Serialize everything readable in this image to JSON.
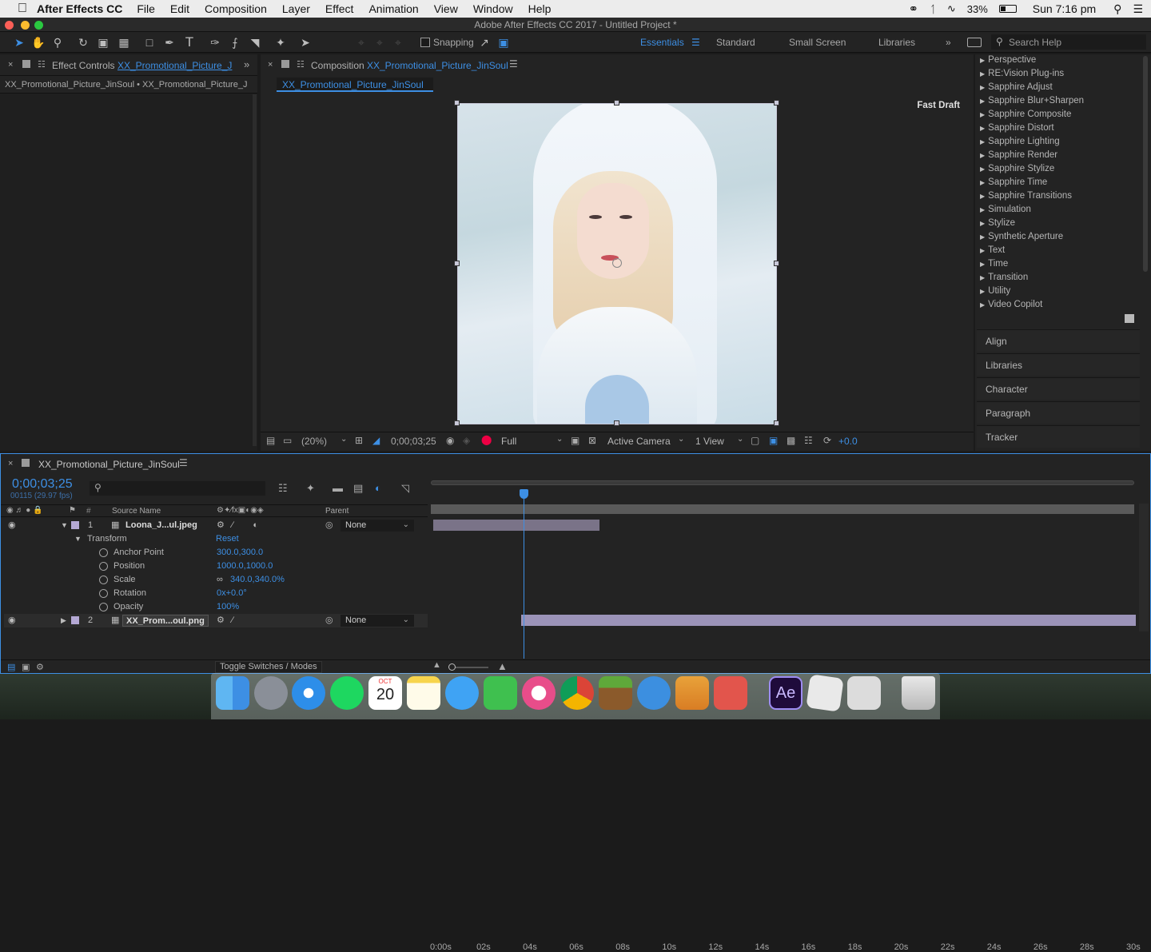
{
  "menubar": {
    "app_name": "After Effects CC",
    "items": [
      "File",
      "Edit",
      "Composition",
      "Layer",
      "Effect",
      "Animation",
      "View",
      "Window",
      "Help"
    ],
    "battery": "33%",
    "clock": "Sun 7:16 pm"
  },
  "window": {
    "title": "Adobe After Effects CC 2017 - Untitled Project *"
  },
  "toolbar": {
    "snapping_label": "Snapping",
    "workspaces": [
      "Essentials",
      "Standard",
      "Small Screen",
      "Libraries"
    ],
    "search_placeholder": "Search Help"
  },
  "effect_controls": {
    "tab_prefix": "Effect Controls",
    "tab_name": "XX_Promotional_Picture_J",
    "breadcrumb": "XX_Promotional_Picture_JinSoul • XX_Promotional_Picture_J"
  },
  "composition": {
    "tab_prefix": "Composition",
    "tab_name": "XX_Promotional_Picture_JinSoul",
    "subtab": "XX_Promotional_Picture_JinSoul",
    "fast_draft": "Fast Draft",
    "zoom": "(20%)",
    "timecode": "0;00;03;25",
    "resolution": "Full",
    "camera": "Active Camera",
    "views": "1 View",
    "exposure": "+0.0"
  },
  "effects_list": [
    "Perspective",
    "RE:Vision Plug-ins",
    "Sapphire Adjust",
    "Sapphire Blur+Sharpen",
    "Sapphire Composite",
    "Sapphire Distort",
    "Sapphire Lighting",
    "Sapphire Render",
    "Sapphire Stylize",
    "Sapphire Time",
    "Sapphire Transitions",
    "Simulation",
    "Stylize",
    "Synthetic Aperture",
    "Text",
    "Time",
    "Transition",
    "Utility",
    "Video Copilot"
  ],
  "side_panels": [
    "Align",
    "Libraries",
    "Character",
    "Paragraph",
    "Tracker"
  ],
  "timeline": {
    "tab_name": "XX_Promotional_Picture_JinSoul",
    "timecode": "0;00;03;25",
    "frame_info": "00115 (29.97 fps)",
    "col_source": "Source Name",
    "col_parent": "Parent",
    "layers": [
      {
        "num": "1",
        "name": "Loona_J...ul.jpeg",
        "parent": "None"
      },
      {
        "num": "2",
        "name": "XX_Prom...oul.png",
        "parent": "None"
      }
    ],
    "transform_label": "Transform",
    "reset_label": "Reset",
    "properties": [
      {
        "name": "Anchor Point",
        "value": "300.0,300.0"
      },
      {
        "name": "Position",
        "value": "1000.0,1000.0"
      },
      {
        "name": "Scale",
        "value": "340.0,340.0%"
      },
      {
        "name": "Rotation",
        "value": "0x+0.0°"
      },
      {
        "name": "Opacity",
        "value": "100%"
      }
    ],
    "ruler": [
      "0:00s",
      "02s",
      "04s",
      "06s",
      "08s",
      "10s",
      "12s",
      "14s",
      "16s",
      "18s",
      "20s",
      "22s",
      "24s",
      "26s",
      "28s",
      "30s"
    ],
    "toggle_label": "Toggle Switches / Modes"
  },
  "dock": {
    "calendar_month": "OCT",
    "calendar_day": "20",
    "ae_label": "Ae"
  }
}
